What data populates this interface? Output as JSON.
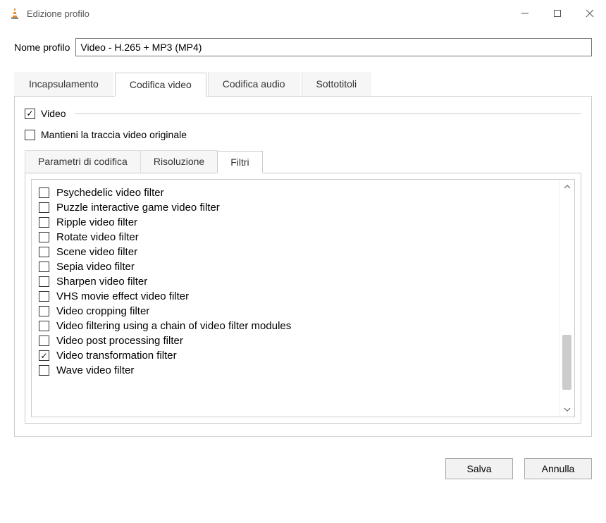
{
  "window": {
    "title": "Edizione profilo"
  },
  "profile": {
    "label": "Nome profilo",
    "value": "Video - H.265 + MP3 (MP4)"
  },
  "tabs_outer": [
    {
      "label": "Incapsulamento",
      "active": false
    },
    {
      "label": "Codifica video",
      "active": true
    },
    {
      "label": "Codifica audio",
      "active": false
    },
    {
      "label": "Sottotitoli",
      "active": false
    }
  ],
  "video_group": {
    "video_checkbox_label": "Video",
    "video_checked": true,
    "keep_label": "Mantieni la traccia video originale",
    "keep_checked": false
  },
  "tabs_inner": [
    {
      "label": "Parametri di codifica",
      "active": false
    },
    {
      "label": "Risoluzione",
      "active": false
    },
    {
      "label": "Filtri",
      "active": true
    }
  ],
  "filters": [
    {
      "label": "Psychedelic video filter",
      "checked": false
    },
    {
      "label": "Puzzle interactive game video filter",
      "checked": false
    },
    {
      "label": "Ripple video filter",
      "checked": false
    },
    {
      "label": "Rotate video filter",
      "checked": false
    },
    {
      "label": "Scene video filter",
      "checked": false
    },
    {
      "label": "Sepia video filter",
      "checked": false
    },
    {
      "label": "Sharpen video filter",
      "checked": false
    },
    {
      "label": "VHS movie effect video filter",
      "checked": false
    },
    {
      "label": "Video cropping filter",
      "checked": false
    },
    {
      "label": "Video filtering using a chain of video filter modules",
      "checked": false
    },
    {
      "label": "Video post processing filter",
      "checked": false
    },
    {
      "label": "Video transformation filter",
      "checked": true
    },
    {
      "label": "Wave video filter",
      "checked": false
    }
  ],
  "buttons": {
    "save": "Salva",
    "cancel": "Annulla"
  }
}
